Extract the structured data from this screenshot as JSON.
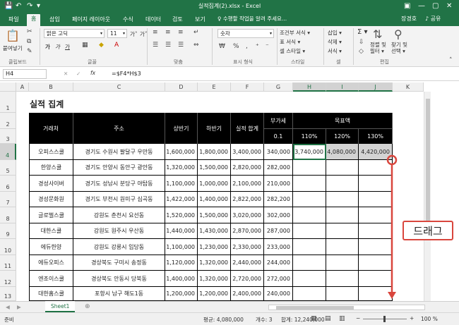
{
  "window": {
    "title": "실적집계(2).xlsx - Excel",
    "quick_access": [
      "💾",
      "↶",
      "↷",
      "▾"
    ],
    "controls": [
      "▣",
      "—",
      "▢",
      "✕"
    ]
  },
  "tabs": [
    "파일",
    "홈",
    "삽입",
    "페이지 레이아웃",
    "수식",
    "데이터",
    "검토",
    "보기"
  ],
  "active_tab": "홈",
  "tell_me": "♀ 수행할 작업을 알려 주세요...",
  "account": {
    "user": "장경호",
    "share": "♪ 공유"
  },
  "ribbon": {
    "clipboard": {
      "paste": "붙여넣기",
      "label": "클립보드"
    },
    "font": {
      "name": "맑은 고딕",
      "size": "11",
      "grow": "가˄",
      "shrink": "가˅",
      "bold": "가",
      "italic": "가",
      "underline": "가",
      "label": "글꼴"
    },
    "align": {
      "label": "맞춤"
    },
    "number": {
      "format": "숫자",
      "label": "표시 형식"
    },
    "styles": {
      "cond": "조건부 서식 ▾",
      "table": "표 서식 ▾",
      "cell": "셀 스타일 ▾",
      "label": "스타일"
    },
    "cells": {
      "insert": "삽입 ▾",
      "delete": "삭제 ▾",
      "format": "서식 ▾",
      "label": "셀"
    },
    "editing": {
      "sort": "정렬 및\n필터 ▾",
      "find": "찾기 및\n선택 ▾",
      "label": "편집",
      "sigma": "Σ ▾"
    }
  },
  "formula_bar": {
    "namebox": "H4",
    "cancel": "✕",
    "enter": "✓",
    "fx": "fx",
    "formula": "=$F4*H$3"
  },
  "columns": [
    "A",
    "B",
    "C",
    "D",
    "E",
    "F",
    "G",
    "H",
    "I",
    "J",
    "K"
  ],
  "rows": [
    "1",
    "2",
    "3",
    "4",
    "5",
    "6",
    "7",
    "8",
    "9",
    "10",
    "11",
    "12",
    "13"
  ],
  "selected_cell": {
    "col": "H",
    "row": "4"
  },
  "sheet": {
    "heading": "실적 집계",
    "headers": {
      "client": "거래처",
      "address": "주소",
      "first": "상반기",
      "second": "하반기",
      "total": "실적 합계",
      "vat": "부가세",
      "vat_rate": "0.1",
      "target": "목표액",
      "t110": "110%",
      "t120": "120%",
      "t130": "130%"
    },
    "rows": [
      {
        "client": "오피스스쿨",
        "address": "경기도 수원시 팔달구 우만동",
        "first": "1,600,000",
        "second": "1,800,000",
        "total": "3,400,000",
        "vat": "340,000",
        "t110": "3,740,000",
        "t120": "4,080,000",
        "t130": "4,420,000"
      },
      {
        "client": "한양스쿨",
        "address": "경기도 안양시 동안구 광안동",
        "first": "1,320,000",
        "second": "1,500,000",
        "total": "2,820,000",
        "vat": "282,000",
        "t110": "",
        "t120": "",
        "t130": ""
      },
      {
        "client": "경성사이버",
        "address": "경기도 성남시 분당구 야탑동",
        "first": "1,100,000",
        "second": "1,000,000",
        "total": "2,100,000",
        "vat": "210,000",
        "t110": "",
        "t120": "",
        "t130": ""
      },
      {
        "client": "경성문화원",
        "address": "경기도 부천시 원미구 심곡동",
        "first": "1,422,000",
        "second": "1,400,000",
        "total": "2,822,000",
        "vat": "282,200",
        "t110": "",
        "t120": "",
        "t130": ""
      },
      {
        "client": "글로벌스쿨",
        "address": "강원도 춘천시 요선동",
        "first": "1,520,000",
        "second": "1,500,000",
        "total": "3,020,000",
        "vat": "302,000",
        "t110": "",
        "t120": "",
        "t130": ""
      },
      {
        "client": "대한스쿨",
        "address": "강원도 원주시 우산동",
        "first": "1,440,000",
        "second": "1,430,000",
        "total": "2,870,000",
        "vat": "287,000",
        "t110": "",
        "t120": "",
        "t130": ""
      },
      {
        "client": "에듀한양",
        "address": "강원도 강릉시 임당동",
        "first": "1,100,000",
        "second": "1,230,000",
        "total": "2,330,000",
        "vat": "233,000",
        "t110": "",
        "t120": "",
        "t130": ""
      },
      {
        "client": "에듀오피스",
        "address": "경상북도 구미시 송정동",
        "first": "1,120,000",
        "second": "1,320,000",
        "total": "2,440,000",
        "vat": "244,000",
        "t110": "",
        "t120": "",
        "t130": ""
      },
      {
        "client": "엔조이스쿨",
        "address": "경상북도 안동시 당북동",
        "first": "1,400,000",
        "second": "1,320,000",
        "total": "2,720,000",
        "vat": "272,000",
        "t110": "",
        "t120": "",
        "t130": ""
      },
      {
        "client": "대한홈스쿨",
        "address": "포항시 남구 해도1동",
        "first": "1,200,000",
        "second": "1,200,000",
        "total": "2,400,000",
        "vat": "240,000",
        "t110": "",
        "t120": "",
        "t130": ""
      }
    ]
  },
  "sheet_tabs": {
    "active": "Sheet1",
    "add": "⊕"
  },
  "status": {
    "ready": "준비",
    "average": "평균: 4,080,000",
    "count": "개수: 3",
    "sum": "합계: 12,240,000",
    "zoom": "100 %"
  },
  "annotation": {
    "drag_label": "드래그",
    "color": "#d9463d"
  },
  "colors": {
    "excel_green": "#217346",
    "header_black": "#000000",
    "highlight_fill": "#d3d3d3"
  }
}
